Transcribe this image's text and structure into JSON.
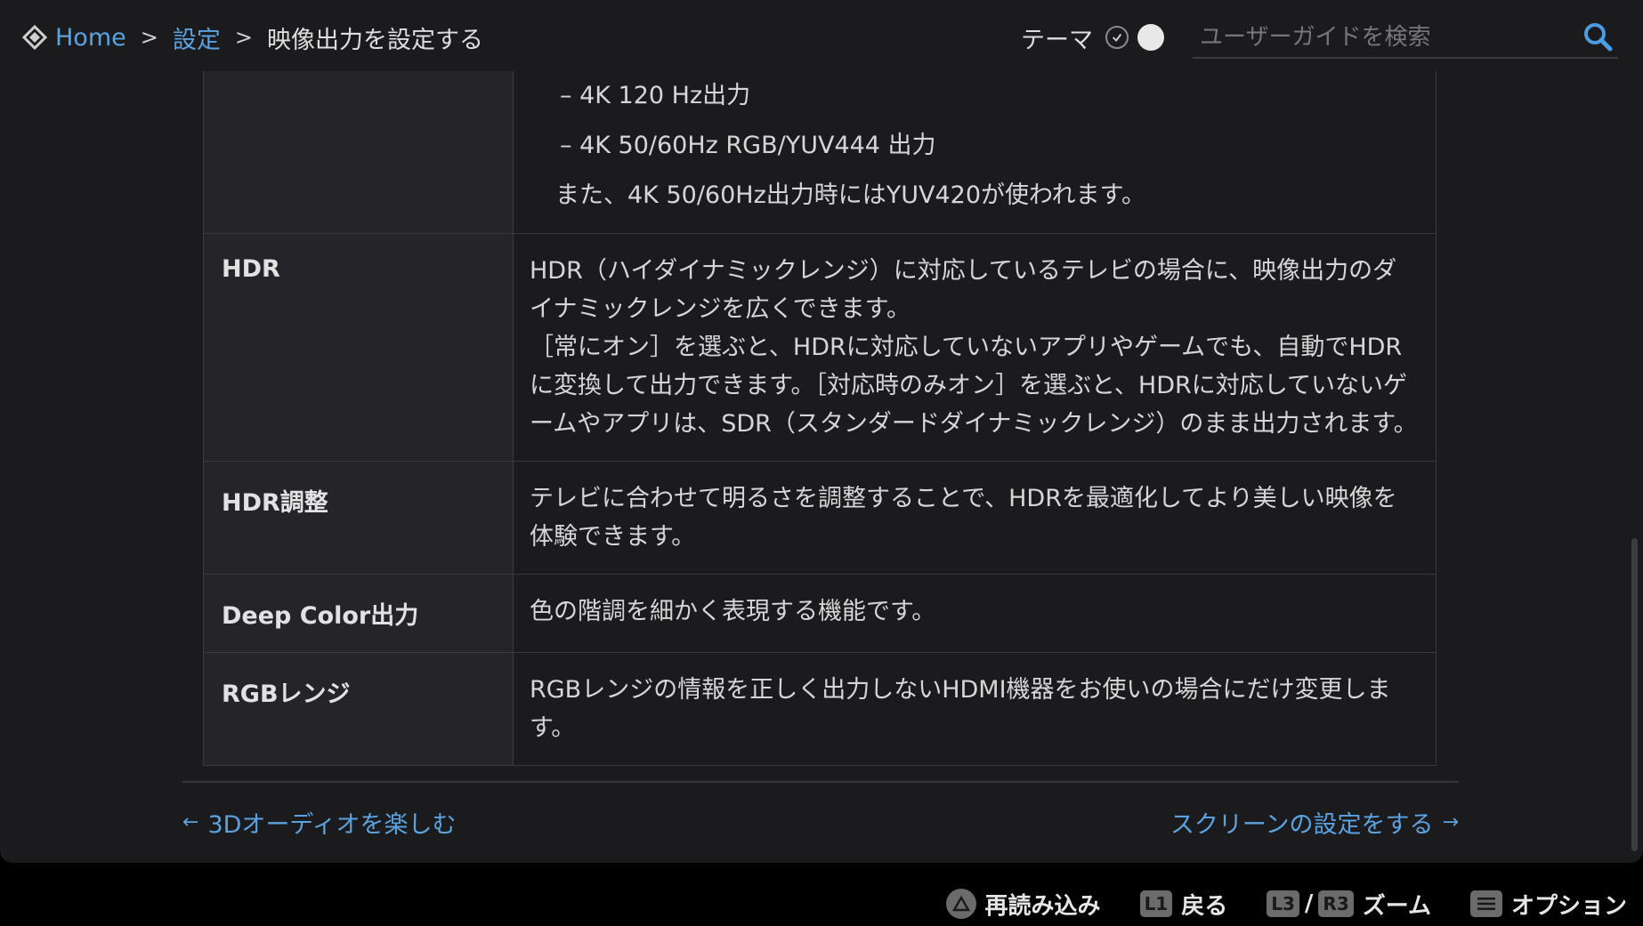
{
  "breadcrumb": {
    "home": "Home",
    "separator": ">",
    "settings": "設定",
    "current": "映像出力を設定する"
  },
  "theme": {
    "label": "テーマ"
  },
  "search": {
    "placeholder": "ユーザーガイドを検索"
  },
  "table": {
    "continued_lines": [
      "– 4K 120 Hz出力",
      "– 4K 50/60Hz RGB/YUV444 出力",
      "また、4K 50/60Hz出力時にはYUV420が使われます。"
    ],
    "rows": [
      {
        "name": "HDR",
        "description": [
          "HDR（ハイダイナミックレンジ）に対応しているテレビの場合に、映像出力のダイナミックレンジを広くできます。",
          "［常にオン］を選ぶと、HDRに対応していないアプリやゲームでも、自動でHDRに変換して出力できます。［対応時のみオン］を選ぶと、HDRに対応していないゲームやアプリは、SDR（スタンダードダイナミックレンジ）のまま出力されます。"
        ]
      },
      {
        "name": "HDR調整",
        "description": [
          "テレビに合わせて明るさを調整することで、HDRを最適化してより美しい映像を体験できます。"
        ]
      },
      {
        "name": "Deep Color出力",
        "description": [
          "色の階調を細かく表現する機能です。"
        ]
      },
      {
        "name": "RGBレンジ",
        "description": [
          "RGBレンジの情報を正しく出力しないHDMI機器をお使いの場合にだけ変更します。"
        ]
      }
    ]
  },
  "nav": {
    "prev": "3Dオーディオを楽しむ",
    "next": "スクリーンの設定をする"
  },
  "hints": {
    "reload": "再読み込み",
    "back_button": "L1",
    "back": "戻る",
    "zoom_button_1": "L3",
    "zoom_slash": "/",
    "zoom_button_2": "R3",
    "zoom": "ズーム",
    "options": "オプション"
  },
  "colors": {
    "background": "#1b1b1e",
    "header_cell": "#252529",
    "link": "#5aa2e0",
    "border": "#3a3a3e"
  }
}
